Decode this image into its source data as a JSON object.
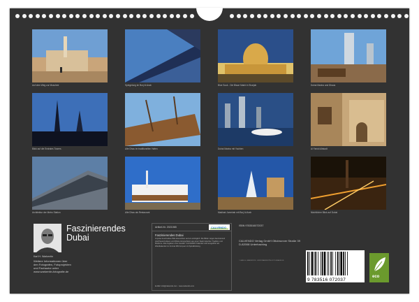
{
  "title": "Faszinierendes",
  "subtitle": "Dubai",
  "author_name": "Karl H. Warkentin",
  "author_text": "Weitere Informationen über den Fotografen, Fotoprojekten und Fachautor unter www.warkentin-fotografie.de",
  "article_label": "Artikel-Nr. 2021065",
  "calvendo_brand": "CALVENDO",
  "info_title": "Faszinierendes Dubai",
  "info_desc": "Impulse beschreiben Bild-übersichten auf ein einträglich. Die Bilder zeigen faszinierend Hochhaus-Kulissen und Wüste Atmosphären aus einer Stadt zwischen Tradition und Moderne. Alle Angaben ohne Gewähr. CALVENDO Kalender wird ausgeführt als Wandkalender im Format DIN A4 quer mit Spiralbindung.",
  "info_foot": "E-Mail: info@calvendo.com · www.calvendo.com",
  "isbn": "ISBN 9783516072037",
  "publisher": "CALVENDO Verlag GmbH Ottobrunner Straße 39 D-82008 Unterhaching",
  "legal": "© KARL H. WARKENTIN · WWW.WARKENTIN-FOTOGRAFIE.DE",
  "barcode_digits": "9 783516 072037",
  "eco_label": "eco",
  "captions": [
    "Auf dem Weg zur Moschee",
    "Spiegelung im Burj Al Arab",
    "Blue Souk - Die Blaue Markt in Sharjah",
    "Dubai Marina und Dhaus",
    "Blick auf die Emirates Towers",
    "Alte Dhau im traditionellen Hafen",
    "Dubai Marina mit Yachten",
    "Al Fahidi Altstadt",
    "Architektur der Metro Station",
    "Alte Dhau als Restaurant",
    "Madinat Jumeirah mit Burj Al Arab",
    "Nächtlicher Blick auf Dubai"
  ]
}
